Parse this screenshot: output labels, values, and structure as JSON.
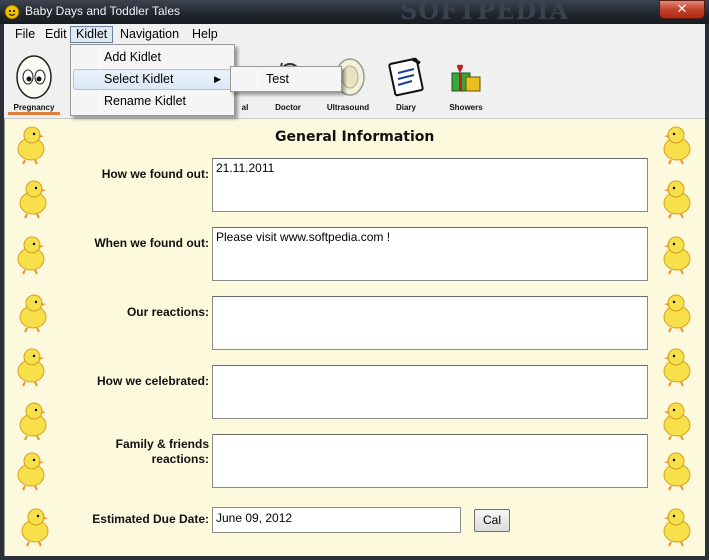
{
  "window": {
    "title": "Baby Days and Toddler Tales",
    "watermark": "SOFTPEDIA",
    "close_label": "✕"
  },
  "menubar": {
    "items": [
      "File",
      "Edit",
      "Kidlet",
      "Navigation",
      "Help"
    ],
    "active": "Kidlet"
  },
  "kidlet_menu": {
    "items": [
      "Add Kidlet",
      "Select Kidlet",
      "Rename Kidlet"
    ],
    "highlighted": "Select Kidlet",
    "submenu_arrow": "▶",
    "submenu_items": [
      "Test"
    ]
  },
  "toolbar": {
    "items": [
      {
        "label": "Pregnancy",
        "icon": "pregnancy-egg-icon",
        "selected": true
      },
      {
        "label": "Prenatal",
        "icon": "prenatal-icon",
        "selected": false
      },
      {
        "label": "Doctor",
        "icon": "doctor-stethoscope-icon",
        "selected": false
      },
      {
        "label": "Ultrasound",
        "icon": "ultrasound-icon",
        "selected": false
      },
      {
        "label": "Diary",
        "icon": "diary-icon",
        "selected": false
      },
      {
        "label": "Showers",
        "icon": "gift-icon",
        "selected": false
      }
    ],
    "visible_partial_label": "al"
  },
  "main": {
    "title": "General Information",
    "fields": [
      {
        "label": "How we found out:",
        "value": "21.11.2011"
      },
      {
        "label": "When we found out:",
        "value": "Please visit www.softpedia.com !"
      },
      {
        "label": "Our reactions:",
        "value": ""
      },
      {
        "label": "How we celebrated:",
        "value": ""
      },
      {
        "label": "Family & friends reactions:",
        "value": ""
      }
    ],
    "due_date": {
      "label": "Estimated Due Date:",
      "value": "June 09, 2012"
    },
    "cal_button": "Cal"
  },
  "colors": {
    "content_bg": "#fdf9dd",
    "selected_underline": "#e0803a",
    "chick_yellow": "#f7e04a"
  }
}
